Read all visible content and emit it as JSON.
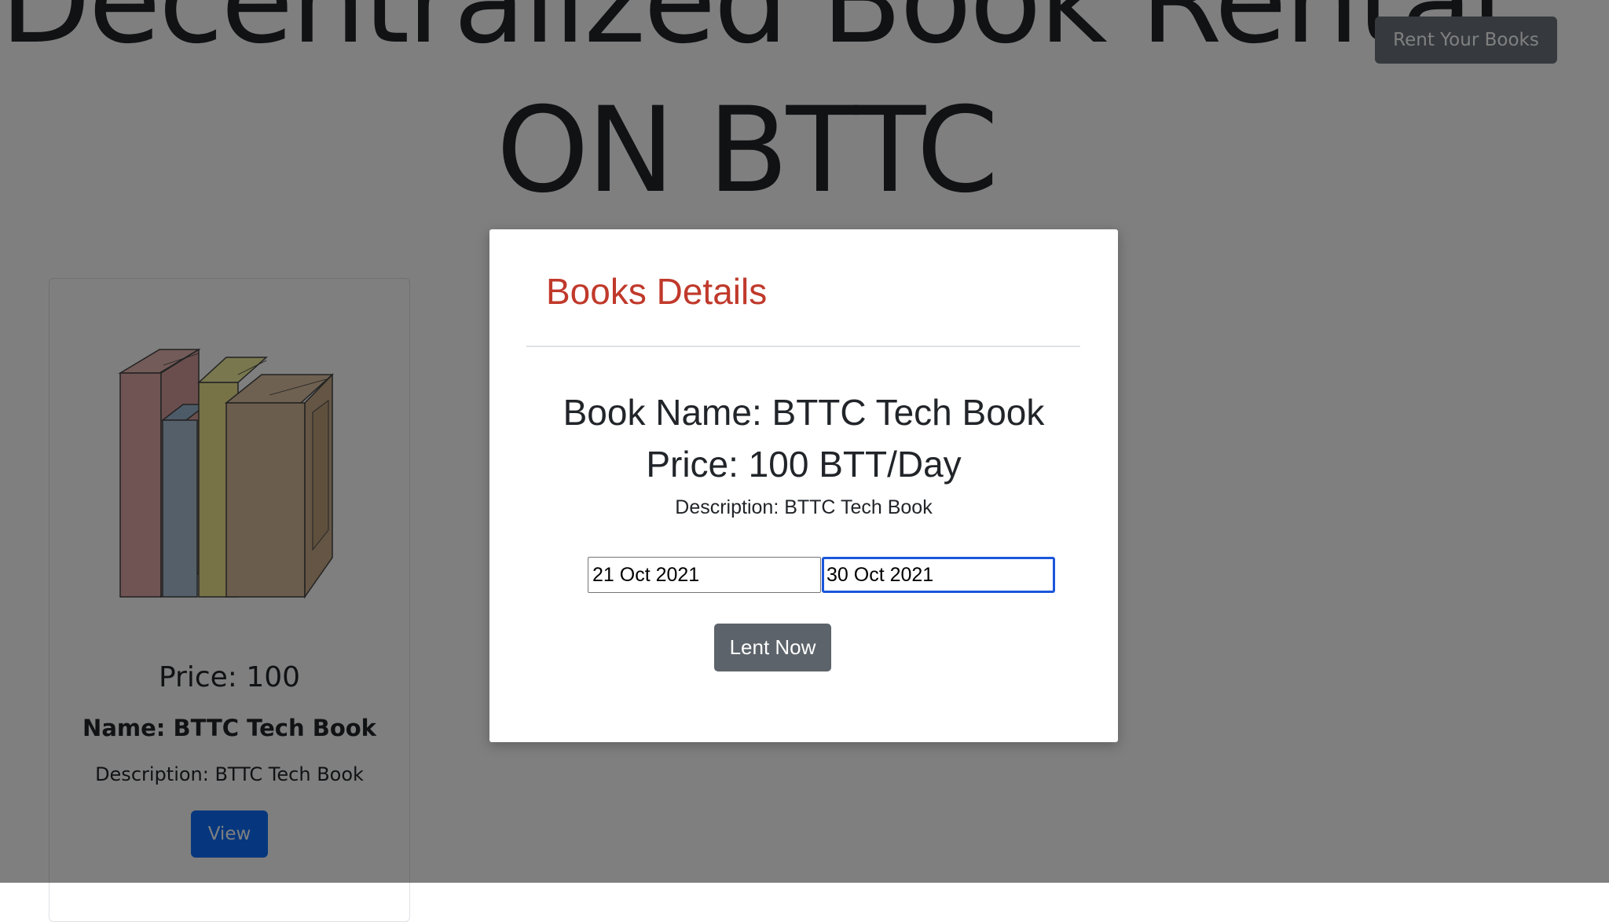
{
  "header": {
    "title_line1": "Decentralized Book Rental",
    "title_line2": "ON BTTC",
    "rent_button_label": "Rent Your Books"
  },
  "card": {
    "price_label": "Price: 100",
    "name_label": "Name: BTTC Tech Book",
    "description_label": "Description: BTTC Tech Book",
    "view_button_label": "View",
    "image_icon": "books-illustration"
  },
  "modal": {
    "title": "Books Details",
    "book_name": "Book Name: BTTC Tech Book",
    "price": "Price: 100 BTT/Day",
    "description": "Description: BTTC Tech Book",
    "start_date": "21 Oct 2021",
    "end_date": "30 Oct 2021",
    "lent_button_label": "Lent Now"
  },
  "colors": {
    "modal_title": "#c0392b",
    "primary_button": "#0d6efd",
    "secondary_button": "#6c757d",
    "backdrop": "rgba(0,0,0,0.5)",
    "focus_border": "#1a56db"
  }
}
